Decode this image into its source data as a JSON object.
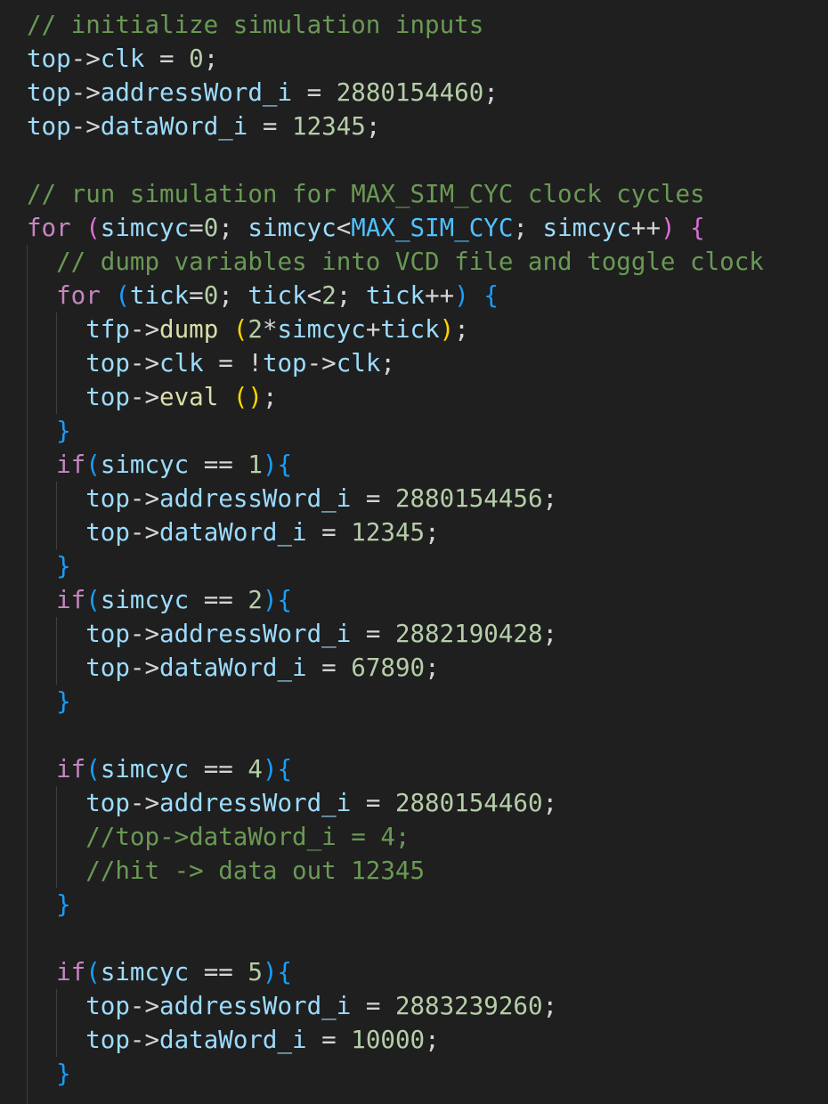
{
  "editor": {
    "language": "cpp",
    "theme": {
      "background": "#1f1f1f",
      "comment": "#6a9955",
      "keyword": "#c586c0",
      "variable": "#9cdcfe",
      "operator": "#d4d4d4",
      "number": "#b5cea8",
      "function": "#dcdcaa",
      "constant": "#4fc1ff",
      "bracket_level_1": "#da70d6",
      "bracket_level_2": "#179fff",
      "bracket_level_3": "#ffd700",
      "indent_guide": "#404040"
    },
    "lines": [
      {
        "indent": 0,
        "tokens": [
          {
            "t": "// initialize simulation inputs",
            "c": "comment"
          }
        ]
      },
      {
        "indent": 0,
        "tokens": [
          {
            "t": "top",
            "c": "var"
          },
          {
            "t": "->",
            "c": "op"
          },
          {
            "t": "clk",
            "c": "var"
          },
          {
            "t": " = ",
            "c": "op"
          },
          {
            "t": "0",
            "c": "num"
          },
          {
            "t": ";",
            "c": "op"
          }
        ]
      },
      {
        "indent": 0,
        "tokens": [
          {
            "t": "top",
            "c": "var"
          },
          {
            "t": "->",
            "c": "op"
          },
          {
            "t": "addressWord_i",
            "c": "var"
          },
          {
            "t": " = ",
            "c": "op"
          },
          {
            "t": "2880154460",
            "c": "num"
          },
          {
            "t": ";",
            "c": "op"
          }
        ]
      },
      {
        "indent": 0,
        "tokens": [
          {
            "t": "top",
            "c": "var"
          },
          {
            "t": "->",
            "c": "op"
          },
          {
            "t": "dataWord_i",
            "c": "var"
          },
          {
            "t": " = ",
            "c": "op"
          },
          {
            "t": "12345",
            "c": "num"
          },
          {
            "t": ";",
            "c": "op"
          }
        ]
      },
      {
        "indent": 0,
        "tokens": []
      },
      {
        "indent": 0,
        "tokens": [
          {
            "t": "// run simulation for MAX_SIM_CYC clock cycles",
            "c": "comment"
          }
        ]
      },
      {
        "indent": 0,
        "tokens": [
          {
            "t": "for",
            "c": "kw"
          },
          {
            "t": " ",
            "c": "op"
          },
          {
            "t": "(",
            "c": "b1"
          },
          {
            "t": "simcyc",
            "c": "var"
          },
          {
            "t": "=",
            "c": "op"
          },
          {
            "t": "0",
            "c": "num"
          },
          {
            "t": "; ",
            "c": "op"
          },
          {
            "t": "simcyc",
            "c": "var"
          },
          {
            "t": "<",
            "c": "op"
          },
          {
            "t": "MAX_SIM_CYC",
            "c": "const"
          },
          {
            "t": "; ",
            "c": "op"
          },
          {
            "t": "simcyc",
            "c": "var"
          },
          {
            "t": "++",
            "c": "op"
          },
          {
            "t": ")",
            "c": "b1"
          },
          {
            "t": " ",
            "c": "op"
          },
          {
            "t": "{",
            "c": "b1"
          }
        ]
      },
      {
        "indent": 1,
        "tokens": [
          {
            "t": "// dump variables into VCD file and toggle clock",
            "c": "comment"
          }
        ]
      },
      {
        "indent": 1,
        "tokens": [
          {
            "t": "for",
            "c": "kw"
          },
          {
            "t": " ",
            "c": "op"
          },
          {
            "t": "(",
            "c": "b2"
          },
          {
            "t": "tick",
            "c": "var"
          },
          {
            "t": "=",
            "c": "op"
          },
          {
            "t": "0",
            "c": "num"
          },
          {
            "t": "; ",
            "c": "op"
          },
          {
            "t": "tick",
            "c": "var"
          },
          {
            "t": "<",
            "c": "op"
          },
          {
            "t": "2",
            "c": "num"
          },
          {
            "t": "; ",
            "c": "op"
          },
          {
            "t": "tick",
            "c": "var"
          },
          {
            "t": "++",
            "c": "op"
          },
          {
            "t": ")",
            "c": "b2"
          },
          {
            "t": " ",
            "c": "op"
          },
          {
            "t": "{",
            "c": "b2"
          }
        ]
      },
      {
        "indent": 2,
        "tokens": [
          {
            "t": "tfp",
            "c": "var"
          },
          {
            "t": "->",
            "c": "op"
          },
          {
            "t": "dump",
            "c": "fn"
          },
          {
            "t": " ",
            "c": "op"
          },
          {
            "t": "(",
            "c": "b3"
          },
          {
            "t": "2",
            "c": "num"
          },
          {
            "t": "*",
            "c": "op"
          },
          {
            "t": "simcyc",
            "c": "var"
          },
          {
            "t": "+",
            "c": "op"
          },
          {
            "t": "tick",
            "c": "var"
          },
          {
            "t": ")",
            "c": "b3"
          },
          {
            "t": ";",
            "c": "op"
          }
        ]
      },
      {
        "indent": 2,
        "tokens": [
          {
            "t": "top",
            "c": "var"
          },
          {
            "t": "->",
            "c": "op"
          },
          {
            "t": "clk",
            "c": "var"
          },
          {
            "t": " = !",
            "c": "op"
          },
          {
            "t": "top",
            "c": "var"
          },
          {
            "t": "->",
            "c": "op"
          },
          {
            "t": "clk",
            "c": "var"
          },
          {
            "t": ";",
            "c": "op"
          }
        ]
      },
      {
        "indent": 2,
        "tokens": [
          {
            "t": "top",
            "c": "var"
          },
          {
            "t": "->",
            "c": "op"
          },
          {
            "t": "eval",
            "c": "fn"
          },
          {
            "t": " ",
            "c": "op"
          },
          {
            "t": "()",
            "c": "b3"
          },
          {
            "t": ";",
            "c": "op"
          }
        ]
      },
      {
        "indent": 1,
        "tokens": [
          {
            "t": "}",
            "c": "b2"
          }
        ]
      },
      {
        "indent": 1,
        "tokens": [
          {
            "t": "if",
            "c": "kw"
          },
          {
            "t": "(",
            "c": "b2"
          },
          {
            "t": "simcyc",
            "c": "var"
          },
          {
            "t": " == ",
            "c": "op"
          },
          {
            "t": "1",
            "c": "num"
          },
          {
            "t": ")",
            "c": "b2"
          },
          {
            "t": "{",
            "c": "b2"
          }
        ]
      },
      {
        "indent": 2,
        "tokens": [
          {
            "t": "top",
            "c": "var"
          },
          {
            "t": "->",
            "c": "op"
          },
          {
            "t": "addressWord_i",
            "c": "var"
          },
          {
            "t": " = ",
            "c": "op"
          },
          {
            "t": "2880154456",
            "c": "num"
          },
          {
            "t": ";",
            "c": "op"
          }
        ]
      },
      {
        "indent": 2,
        "tokens": [
          {
            "t": "top",
            "c": "var"
          },
          {
            "t": "->",
            "c": "op"
          },
          {
            "t": "dataWord_i",
            "c": "var"
          },
          {
            "t": " = ",
            "c": "op"
          },
          {
            "t": "12345",
            "c": "num"
          },
          {
            "t": ";",
            "c": "op"
          }
        ]
      },
      {
        "indent": 1,
        "tokens": [
          {
            "t": "}",
            "c": "b2"
          }
        ]
      },
      {
        "indent": 1,
        "tokens": [
          {
            "t": "if",
            "c": "kw"
          },
          {
            "t": "(",
            "c": "b2"
          },
          {
            "t": "simcyc",
            "c": "var"
          },
          {
            "t": " == ",
            "c": "op"
          },
          {
            "t": "2",
            "c": "num"
          },
          {
            "t": ")",
            "c": "b2"
          },
          {
            "t": "{",
            "c": "b2"
          }
        ]
      },
      {
        "indent": 2,
        "tokens": [
          {
            "t": "top",
            "c": "var"
          },
          {
            "t": "->",
            "c": "op"
          },
          {
            "t": "addressWord_i",
            "c": "var"
          },
          {
            "t": " = ",
            "c": "op"
          },
          {
            "t": "2882190428",
            "c": "num"
          },
          {
            "t": ";",
            "c": "op"
          }
        ]
      },
      {
        "indent": 2,
        "tokens": [
          {
            "t": "top",
            "c": "var"
          },
          {
            "t": "->",
            "c": "op"
          },
          {
            "t": "dataWord_i",
            "c": "var"
          },
          {
            "t": " = ",
            "c": "op"
          },
          {
            "t": "67890",
            "c": "num"
          },
          {
            "t": ";",
            "c": "op"
          }
        ]
      },
      {
        "indent": 1,
        "tokens": [
          {
            "t": "}",
            "c": "b2"
          }
        ]
      },
      {
        "indent": 1,
        "tokens": []
      },
      {
        "indent": 1,
        "tokens": [
          {
            "t": "if",
            "c": "kw"
          },
          {
            "t": "(",
            "c": "b2"
          },
          {
            "t": "simcyc",
            "c": "var"
          },
          {
            "t": " == ",
            "c": "op"
          },
          {
            "t": "4",
            "c": "num"
          },
          {
            "t": ")",
            "c": "b2"
          },
          {
            "t": "{",
            "c": "b2"
          }
        ]
      },
      {
        "indent": 2,
        "tokens": [
          {
            "t": "top",
            "c": "var"
          },
          {
            "t": "->",
            "c": "op"
          },
          {
            "t": "addressWord_i",
            "c": "var"
          },
          {
            "t": " = ",
            "c": "op"
          },
          {
            "t": "2880154460",
            "c": "num"
          },
          {
            "t": ";",
            "c": "op"
          }
        ]
      },
      {
        "indent": 2,
        "tokens": [
          {
            "t": "//top->dataWord_i = 4;",
            "c": "comment"
          }
        ]
      },
      {
        "indent": 2,
        "tokens": [
          {
            "t": "//hit -> data out 12345",
            "c": "comment"
          }
        ]
      },
      {
        "indent": 1,
        "tokens": [
          {
            "t": "}",
            "c": "b2"
          }
        ]
      },
      {
        "indent": 1,
        "tokens": []
      },
      {
        "indent": 1,
        "tokens": [
          {
            "t": "if",
            "c": "kw"
          },
          {
            "t": "(",
            "c": "b2"
          },
          {
            "t": "simcyc",
            "c": "var"
          },
          {
            "t": " == ",
            "c": "op"
          },
          {
            "t": "5",
            "c": "num"
          },
          {
            "t": ")",
            "c": "b2"
          },
          {
            "t": "{",
            "c": "b2"
          }
        ]
      },
      {
        "indent": 2,
        "tokens": [
          {
            "t": "top",
            "c": "var"
          },
          {
            "t": "->",
            "c": "op"
          },
          {
            "t": "addressWord_i",
            "c": "var"
          },
          {
            "t": " = ",
            "c": "op"
          },
          {
            "t": "2883239260",
            "c": "num"
          },
          {
            "t": ";",
            "c": "op"
          }
        ]
      },
      {
        "indent": 2,
        "tokens": [
          {
            "t": "top",
            "c": "var"
          },
          {
            "t": "->",
            "c": "op"
          },
          {
            "t": "dataWord_i",
            "c": "var"
          },
          {
            "t": " = ",
            "c": "op"
          },
          {
            "t": "10000",
            "c": "num"
          },
          {
            "t": ";",
            "c": "op"
          }
        ]
      },
      {
        "indent": 1,
        "tokens": [
          {
            "t": "}",
            "c": "b2"
          }
        ]
      }
    ]
  }
}
